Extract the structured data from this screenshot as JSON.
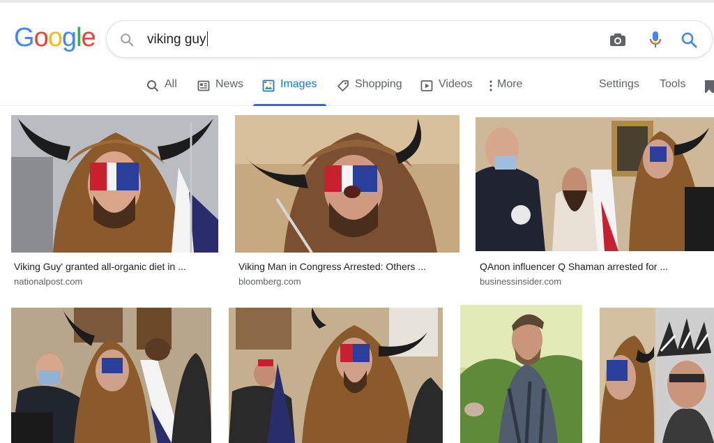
{
  "logo": {
    "text": "Google",
    "letters": [
      {
        "ch": "G",
        "color": "#4285F4"
      },
      {
        "ch": "o",
        "color": "#EA4335"
      },
      {
        "ch": "o",
        "color": "#FBBC05"
      },
      {
        "ch": "g",
        "color": "#4285F4"
      },
      {
        "ch": "l",
        "color": "#34A853"
      },
      {
        "ch": "e",
        "color": "#EA4335"
      }
    ]
  },
  "search": {
    "query": "viking guy",
    "icons": [
      "search-lens-icon",
      "camera-icon",
      "microphone-icon",
      "search-icon"
    ]
  },
  "tabs": [
    {
      "label": "All",
      "icon": "search-icon"
    },
    {
      "label": "News",
      "icon": "newspaper-icon"
    },
    {
      "label": "Images",
      "icon": "image-icon",
      "active": true
    },
    {
      "label": "Shopping",
      "icon": "tag-icon"
    },
    {
      "label": "Videos",
      "icon": "play-icon"
    },
    {
      "label": "More",
      "icon": "more-vert-icon"
    }
  ],
  "tools": {
    "settings": "Settings",
    "tools": "Tools"
  },
  "results": [
    {
      "caption": "Viking Guy' granted all-organic diet in ...",
      "source": "nationalpost.com"
    },
    {
      "caption": "Viking Man in Congress Arrested: Others ...",
      "source": "bloomberg.com"
    },
    {
      "caption": "QAnon influencer Q Shaman arrested for ...",
      "source": "businessinsider.com"
    },
    {
      "caption": "",
      "source": ""
    },
    {
      "caption": "",
      "source": ""
    },
    {
      "caption": "",
      "source": ""
    },
    {
      "caption": "",
      "source": ""
    }
  ],
  "colors": {
    "accent": "#1a73e8",
    "muted": "#5f6368",
    "text": "#202124"
  }
}
